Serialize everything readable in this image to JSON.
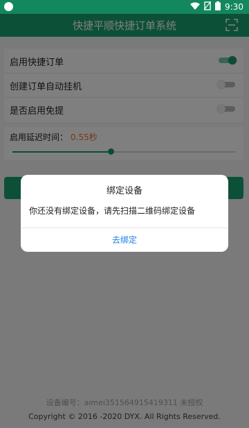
{
  "status": {
    "time": "9:30"
  },
  "app": {
    "title": "快捷平顺快捷订单系统"
  },
  "settings": [
    {
      "label": "启用快捷订单",
      "on": true
    },
    {
      "label": "创建订单自动挂机",
      "on": false
    },
    {
      "label": "是否启用免提",
      "on": false
    }
  ],
  "delay": {
    "label": "启用延迟时间：",
    "value": "0.55秒",
    "fraction": 0.44
  },
  "footer": {
    "device": "设备编号：aimei351564915419311 未授权",
    "copyright": "Copyright © 2016 -2020 DYX. All Rights Reserved."
  },
  "dialog": {
    "title": "绑定设备",
    "message": "你还没有绑定设备，请先扫描二维码绑定设备",
    "button": "去绑定"
  },
  "colors": {
    "primary": "#18a06f",
    "accent_value": "#e9722d",
    "link": "#1c7fe0"
  }
}
